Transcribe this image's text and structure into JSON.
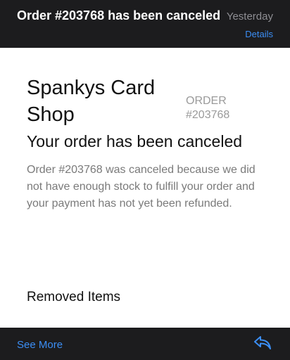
{
  "header": {
    "subject": "Order #203768 has been canceled",
    "date": "Yesterday",
    "details_label": "Details"
  },
  "email": {
    "shop_name": "Spankys Card Shop",
    "order_label": "ORDER #203768",
    "headline": "Your order has been canceled",
    "message": "Order #203768 was canceled because we did not have enough stock to fulfill your order and your payment has not yet been refunded.",
    "removed_items_heading": "Removed Items"
  },
  "footer": {
    "see_more_label": "See More",
    "reply_icon": "reply-icon"
  },
  "colors": {
    "background": "#1c1c1e",
    "accent": "#3b8ef5",
    "card": "#ffffff",
    "muted_text": "#7a7a7a"
  }
}
